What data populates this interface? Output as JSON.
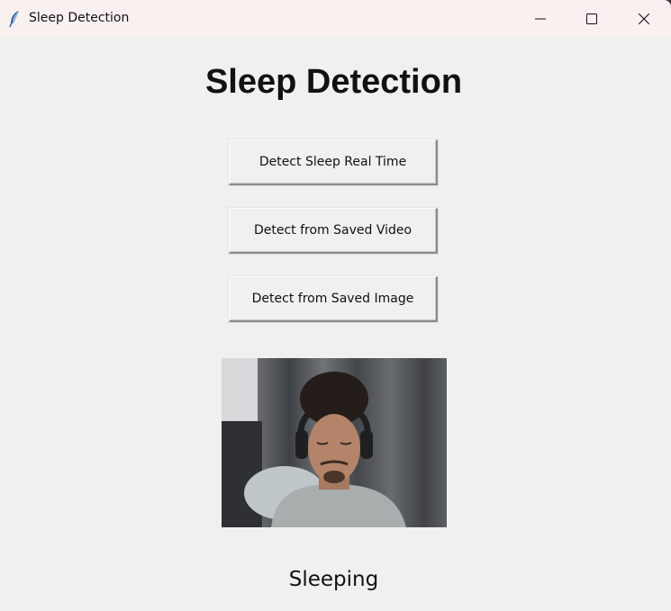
{
  "window": {
    "title": "Sleep Detection",
    "controls": {
      "minimize_icon": "minimize-icon",
      "maximize_icon": "maximize-icon",
      "close_icon": "close-icon"
    }
  },
  "app": {
    "heading": "Sleep Detection",
    "buttons": [
      {
        "label": "Detect Sleep Real Time"
      },
      {
        "label": "Detect from Saved Video"
      },
      {
        "label": "Detect from Saved Image"
      }
    ],
    "status": "Sleeping"
  },
  "colors": {
    "window_bg": "#f0f0f0",
    "titlebar_bg": "#f9f1ef",
    "text": "#111111"
  }
}
